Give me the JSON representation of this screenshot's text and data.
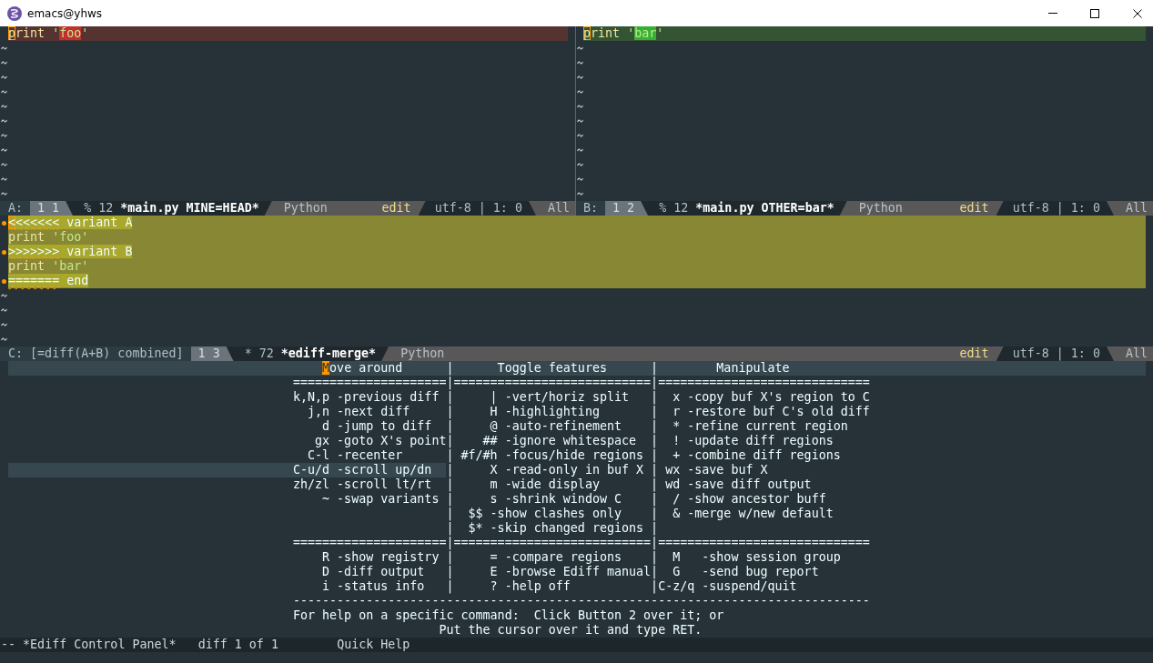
{
  "window": {
    "title": "emacs@yhws"
  },
  "panes": [
    {
      "kind": "variant_a",
      "lines": [
        {
          "in_diff": true,
          "cursor": true,
          "flagged": false,
          "tokens": [
            {
              "text": "print",
              "kind": "builtin",
              "fine": false
            },
            {
              "text": " '",
              "kind": "string",
              "fine": false
            },
            {
              "text": "foo",
              "kind": "string",
              "fine": true
            },
            {
              "text": "'",
              "kind": "string",
              "fine": false
            }
          ]
        }
      ],
      "mode_line": {
        "label": "A:",
        "window_number": "1 1",
        "size": "% 12",
        "buffer": "*main.py MINE=HEAD*",
        "mode": "Python",
        "state": "edit",
        "encoding": "utf-8 | 1: 0",
        "scroll": "All"
      }
    },
    {
      "kind": "variant_b",
      "lines": [
        {
          "in_diff": true,
          "cursor": true,
          "flagged": false,
          "tokens": [
            {
              "text": "print",
              "kind": "builtin",
              "fine": false
            },
            {
              "text": " '",
              "kind": "string",
              "fine": false
            },
            {
              "text": "bar",
              "kind": "string",
              "fine": true
            },
            {
              "text": "'",
              "kind": "string",
              "fine": false
            }
          ]
        }
      ],
      "mode_line": {
        "label": "B:",
        "window_number": "1 2",
        "size": "% 12",
        "buffer": "*main.py OTHER=bar*",
        "mode": "Python",
        "state": "edit",
        "encoding": "utf-8 | 1: 0",
        "scroll": "All"
      }
    },
    {
      "kind": "merged",
      "lines": [
        {
          "in_diff": true,
          "cursor": true,
          "flagged": true,
          "tokens": [
            {
              "text": "<<<<<<<",
              "kind": "marker",
              "fine": true
            },
            {
              "text": " variant A",
              "kind": "plain",
              "fine": true
            }
          ]
        },
        {
          "in_diff": true,
          "cursor": false,
          "flagged": false,
          "tokens": [
            {
              "text": "print",
              "kind": "builtin",
              "fine": false
            },
            {
              "text": " 'foo'",
              "kind": "string",
              "fine": false
            }
          ]
        },
        {
          "in_diff": true,
          "cursor": false,
          "flagged": true,
          "tokens": [
            {
              "text": ">>>>>>>",
              "kind": "marker",
              "fine": true
            },
            {
              "text": " variant B",
              "kind": "plain",
              "fine": true
            }
          ]
        },
        {
          "in_diff": true,
          "cursor": false,
          "flagged": false,
          "tokens": [
            {
              "text": "print",
              "kind": "builtin",
              "fine": false
            },
            {
              "text": " 'bar'",
              "kind": "string",
              "fine": false
            }
          ]
        },
        {
          "in_diff": true,
          "cursor": false,
          "flagged": true,
          "tokens": [
            {
              "text": "=======",
              "kind": "marker",
              "fine": true
            },
            {
              "text": " end",
              "kind": "plain",
              "fine": true
            }
          ]
        }
      ],
      "mode_line": {
        "label": "C: [=diff(A+B) combined]",
        "window_number": "1 3",
        "size": "* 72",
        "buffer": "*ediff-merge*",
        "mode": "Python",
        "state": "edit",
        "encoding": "utf-8 | 1: 0",
        "scroll": "All"
      }
    }
  ],
  "control_panel": {
    "rows": [
      {
        "kind": "header",
        "cursor": true,
        "hovered": false,
        "left": "    Move around",
        "middle": "|      Toggle features",
        "right": "|        Manipulate"
      },
      {
        "kind": "rule",
        "cursor": false,
        "hovered": false,
        "left": "=====================",
        "middle": "|===========================",
        "right": "|============================="
      },
      {
        "kind": "entry",
        "cursor": false,
        "hovered": false,
        "left": "k,N,p -previous diff",
        "middle": "|     | -vert/horiz split",
        "right": "|  x -copy buf X's region to C"
      },
      {
        "kind": "entry",
        "cursor": false,
        "hovered": false,
        "left": "  j,n -next diff",
        "middle": "|     H -highlighting",
        "right": "|  r -restore buf C's old diff"
      },
      {
        "kind": "entry",
        "cursor": false,
        "hovered": false,
        "left": "    d -jump to diff",
        "middle": "|     @ -auto-refinement",
        "right": "|  * -refine current region"
      },
      {
        "kind": "entry",
        "cursor": false,
        "hovered": false,
        "left": "   gx -goto X's point",
        "middle": "|    ## -ignore whitespace",
        "right": "|  ! -update diff regions"
      },
      {
        "kind": "entry",
        "cursor": false,
        "hovered": false,
        "left": "  C-l -recenter",
        "middle": "| #f/#h -focus/hide regions",
        "right": "|  + -combine diff regions"
      },
      {
        "kind": "entry",
        "cursor": false,
        "hovered": true,
        "left": "C-u/d -scroll up/dn",
        "middle": "|     X -read-only in buf X",
        "right": "| wx -save buf X"
      },
      {
        "kind": "entry",
        "cursor": false,
        "hovered": false,
        "left": "zh/zl -scroll lt/rt",
        "middle": "|     m -wide display",
        "right": "| wd -save diff output"
      },
      {
        "kind": "entry",
        "cursor": false,
        "hovered": false,
        "left": "    ~ -swap variants",
        "middle": "|     s -shrink window C",
        "right": "|  / -show ancestor buff"
      },
      {
        "kind": "entry",
        "cursor": false,
        "hovered": false,
        "middle": "|  $$ -show clashes only",
        "right": "|  & -merge w/new default"
      },
      {
        "kind": "entry",
        "cursor": false,
        "hovered": false,
        "middle": "|  $* -skip changed regions",
        "right": "|"
      },
      {
        "kind": "rule",
        "cursor": false,
        "hovered": false,
        "left": "=====================",
        "middle": "|===========================",
        "right": "|============================="
      },
      {
        "kind": "entry",
        "cursor": false,
        "hovered": false,
        "left": "    R -show registry",
        "middle": "|     = -compare regions",
        "right": "|  M   -show session group"
      },
      {
        "kind": "entry",
        "cursor": false,
        "hovered": false,
        "left": "    D -diff output",
        "middle": "|     E -browse Ediff manual",
        "right": "|  G   -send bug report"
      },
      {
        "kind": "entry",
        "cursor": false,
        "hovered": false,
        "left": "    i -status info",
        "middle": "|     ? -help off",
        "right": "|C-z/q -suspend/quit"
      }
    ],
    "footer": [
      "-------------------------------------------------------------------------------",
      "For help on a specific command:  Click Button 2 over it; or",
      "                    Put the cursor over it and type RET."
    ],
    "mode_line": {
      "buffer": "-- *Ediff Control Panel*",
      "status": "diff 1 of 1",
      "help": "Quick Help"
    }
  }
}
